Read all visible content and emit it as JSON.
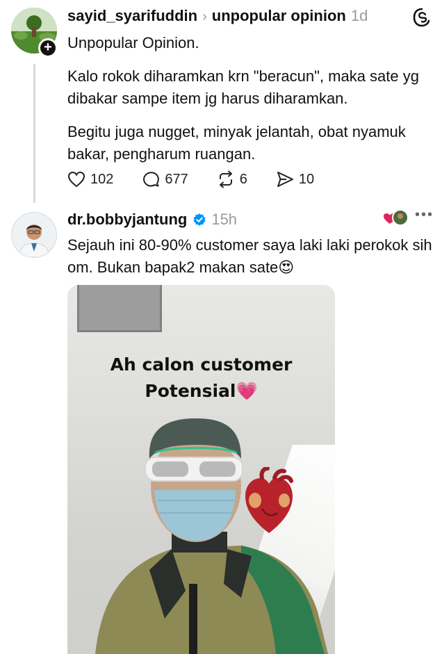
{
  "post1": {
    "username": "sayid_syarifuddin",
    "chevron": "›",
    "topic": "unpopular opinion",
    "time": "1d",
    "follow_symbol": "+",
    "paragraphs": [
      "Unpopular Opinion.",
      "Kalo rokok diharamkan krn \"beracun\", maka sate yg dibakar sampe item jg harus diharamkan.",
      "Begitu juga nugget, minyak jelantah, obat nyamuk bakar, pengharum ruangan."
    ],
    "actions": {
      "likes": "102",
      "comments": "677",
      "reposts": "6",
      "shares": "10"
    }
  },
  "post2": {
    "username": "dr.bobbyjantung",
    "time": "15h",
    "more": "•••",
    "text": "Sejauh ini 80-90% customer saya laki laki perokok sih om. Bukan bapak2 makan sate😍",
    "media": {
      "caption_line1": "Ah calon customer",
      "caption_line2": "Potensial💗"
    }
  },
  "icons": {
    "app_logo": "threads-logo-icon",
    "like": "heart-icon",
    "comment": "comment-icon",
    "repost": "repost-icon",
    "share": "share-icon",
    "verified": "verified-badge-icon"
  },
  "colors": {
    "verified_blue": "#0095f6",
    "muted": "#9a9a9a",
    "scrub_green": "#2e7d4f"
  }
}
